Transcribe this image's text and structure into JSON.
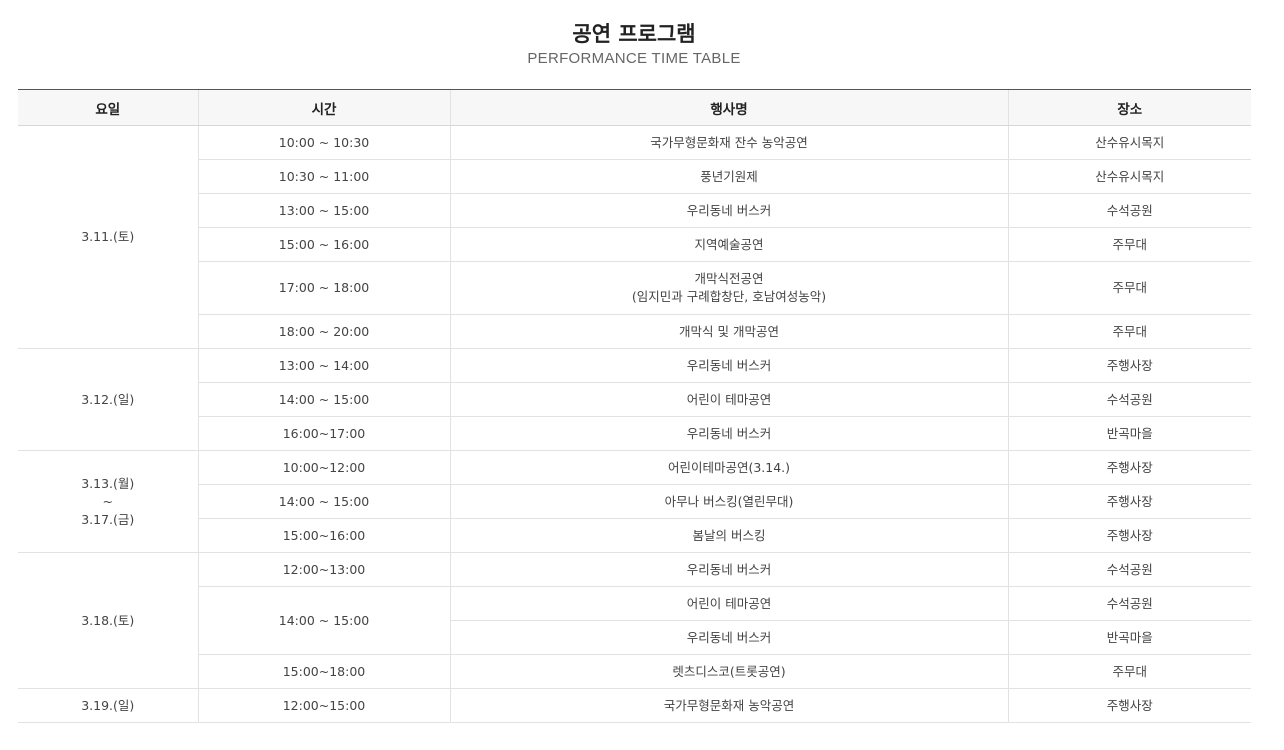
{
  "header": {
    "title": "공연 프로그램",
    "subtitle": "PERFORMANCE TIME TABLE"
  },
  "table": {
    "columns": [
      "요일",
      "시간",
      "행사명",
      "장소"
    ],
    "days": [
      {
        "day": "3.11.(토)",
        "rows": [
          {
            "time": "10:00 ~ 10:30",
            "event": "국가무형문화재 잔수 농악공연",
            "place": "산수유시목지"
          },
          {
            "time": "10:30 ~ 11:00",
            "event": "풍년기원제",
            "place": "산수유시목지"
          },
          {
            "time": "13:00 ~ 15:00",
            "event": "우리동네 버스커",
            "place": "수석공원"
          },
          {
            "time": "15:00 ~ 16:00",
            "event": "지역예술공연",
            "place": "주무대"
          },
          {
            "time": "17:00 ~ 18:00",
            "event": "개막식전공연",
            "event_line2": "(임지민과 구례합창단, 호남여성농악)",
            "place": "주무대"
          },
          {
            "time": "18:00 ~ 20:00",
            "event": "개막식 및 개막공연",
            "place": "주무대"
          }
        ]
      },
      {
        "day": "3.12.(일)",
        "rows": [
          {
            "time": "13:00 ~ 14:00",
            "event": "우리동네 버스커",
            "place": "주행사장"
          },
          {
            "time": "14:00 ~ 15:00",
            "event": "어린이 테마공연",
            "place": "수석공원"
          },
          {
            "time": "16:00~17:00",
            "event": "우리동네 버스커",
            "place": "반곡마을"
          }
        ]
      },
      {
        "day": "3.13.(월)",
        "day_sep": "~",
        "day_end": "3.17.(금)",
        "rows": [
          {
            "time": "10:00~12:00",
            "event": "어린이테마공연(3.14.)",
            "place": "주행사장"
          },
          {
            "time": "14:00 ~ 15:00",
            "event": "아무나 버스킹(열린무대)",
            "place": "주행사장"
          },
          {
            "time": "15:00~16:00",
            "event": "봄날의 버스킹",
            "place": "주행사장"
          }
        ]
      },
      {
        "day": "3.18.(토)",
        "rows": [
          {
            "time": "12:00~13:00",
            "event": "우리동네 버스커",
            "place": "수석공원"
          },
          {
            "time": "14:00 ~ 15:00",
            "event": "어린이 테마공연",
            "place": "수석공원"
          },
          {
            "event": "우리동네 버스커",
            "place": "반곡마을"
          },
          {
            "time": "15:00~18:00",
            "event": "렛츠디스코(트롯공연)",
            "place": "주무대"
          }
        ]
      },
      {
        "day": "3.19.(일)",
        "rows": [
          {
            "time": "12:00~15:00",
            "event": "국가무형문화재 농악공연",
            "place": "주행사장"
          }
        ]
      }
    ]
  }
}
